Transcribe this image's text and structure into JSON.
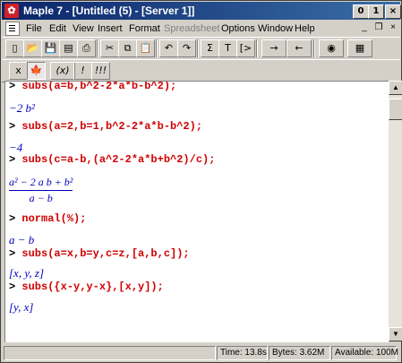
{
  "window": {
    "app_icon": "maple-leaf-icon",
    "title": "Maple 7  - [Untitled (5) - [Server 1]]",
    "controls": {
      "minimize": "0",
      "maximize": "1",
      "close": "×"
    }
  },
  "menubar": {
    "items": [
      {
        "label": "File",
        "enabled": true
      },
      {
        "label": "Edit",
        "enabled": true
      },
      {
        "label": "View",
        "enabled": true
      },
      {
        "label": "Insert",
        "enabled": true
      },
      {
        "label": "Format",
        "enabled": true
      },
      {
        "label": "Spreadsheet",
        "enabled": false
      },
      {
        "label": "Options",
        "enabled": true
      },
      {
        "label": "Window",
        "enabled": true
      },
      {
        "label": "Help",
        "enabled": true
      }
    ],
    "mdi_controls": {
      "minimize": "_",
      "restore": "❐",
      "close": "×"
    }
  },
  "toolbar1": [
    {
      "name": "new-icon",
      "glyph": "▯"
    },
    {
      "name": "open-icon",
      "glyph": "📂"
    },
    {
      "name": "save-icon",
      "glyph": "💾"
    },
    {
      "name": "save-all-icon",
      "glyph": "▤"
    },
    {
      "name": "print-icon",
      "glyph": "⎙"
    },
    {
      "name": "cut-icon",
      "glyph": "✂"
    },
    {
      "name": "copy-icon",
      "glyph": "⧉"
    },
    {
      "name": "paste-icon",
      "glyph": "📋"
    },
    {
      "name": "undo-icon",
      "glyph": "↶"
    },
    {
      "name": "redo-icon",
      "glyph": "↷"
    },
    {
      "name": "sigma-icon",
      "glyph": "Σ"
    },
    {
      "name": "text-icon",
      "glyph": "T"
    },
    {
      "name": "input-icon",
      "glyph": "[>"
    },
    {
      "name": "indent-icon",
      "glyph": "→"
    },
    {
      "name": "outdent-icon",
      "glyph": "←"
    },
    {
      "name": "stop-icon",
      "glyph": "◉"
    },
    {
      "name": "restart-icon",
      "glyph": "▦"
    }
  ],
  "toolbar2": [
    {
      "name": "math-mode-icon",
      "glyph": "x"
    },
    {
      "name": "maple-mode-icon",
      "glyph": "🍁"
    },
    {
      "name": "symbol-icon",
      "glyph": "(x)"
    },
    {
      "name": "execute-icon",
      "glyph": "!"
    },
    {
      "name": "execute-all-icon",
      "glyph": "!!!"
    }
  ],
  "worksheet": {
    "prompt": ">",
    "lines": [
      {
        "type": "input",
        "text": "subs(a=b,b^2-2*a*b-b^2);"
      },
      {
        "type": "output",
        "text": "−2 b²"
      },
      {
        "type": "input",
        "text": "subs(a=2,b=1,b^2-2*a*b-b^2);"
      },
      {
        "type": "output",
        "text": "−4"
      },
      {
        "type": "input",
        "text": "subs(c=a-b,(a^2-2*a*b+b^2)/c);"
      },
      {
        "type": "fraction",
        "numerator": "a² − 2 a b + b²",
        "denominator": "a − b"
      },
      {
        "type": "input",
        "text": "normal(%);"
      },
      {
        "type": "output",
        "text": "a − b"
      },
      {
        "type": "input",
        "text": "subs(a=x,b=y,c=z,[a,b,c]);"
      },
      {
        "type": "output",
        "text": "[x, y, z]"
      },
      {
        "type": "input",
        "text": "subs({x-y,y-x},[x,y]);"
      },
      {
        "type": "output",
        "text": "[y, x]"
      }
    ]
  },
  "status": {
    "time": "Time: 13.8s",
    "bytes": "Bytes: 3.62M",
    "available": "Available: 100M"
  }
}
